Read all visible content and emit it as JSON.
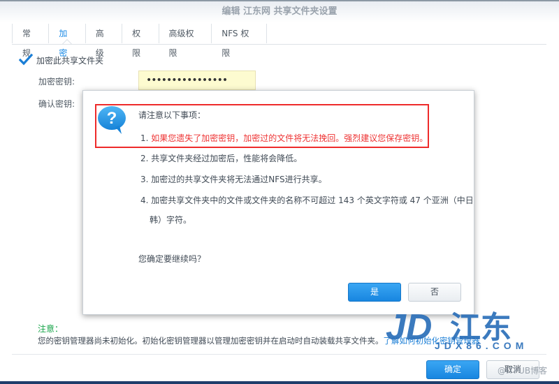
{
  "window": {
    "title": "编辑 江东网 共享文件夹设置"
  },
  "tabs": [
    {
      "label": "常规",
      "active": false
    },
    {
      "label": "加密",
      "active": true
    },
    {
      "label": "高级",
      "active": false
    },
    {
      "label": "权限",
      "active": false
    },
    {
      "label": "高级权限",
      "active": false
    },
    {
      "label": "NFS 权限",
      "active": false
    }
  ],
  "form": {
    "encrypt_checkbox_label": "加密此共享文件夹",
    "encrypt_checked": true,
    "encryption_key_label": "加密密钥:",
    "encryption_key_value": "••••••••••••••••",
    "confirm_key_label": "确认密钥:"
  },
  "dialog": {
    "icon": "question-bubble-icon",
    "heading": "请注意以下事项：",
    "items": [
      {
        "num": "1.",
        "text": "如果您遗失了加密密钥，加密过的文件将无法挽回。强烈建议您保存密钥。",
        "highlighted": true
      },
      {
        "num": "2.",
        "text": "共享文件夹经过加密后，性能将会降低。"
      },
      {
        "num": "3.",
        "text": "加密过的共享文件夹将无法通过NFS进行共享。"
      },
      {
        "num": "4.",
        "text": "加密共享文件夹中的文件或文件夹的名称不可超过 143 个英文字符或 47 个亚洲（中日",
        "continuation": "韩）字符。"
      }
    ],
    "question": "您确定要继续吗？",
    "yes_label": "是",
    "no_label": "否"
  },
  "note": {
    "title": "注意：",
    "text": "您的密钥管理器尚未初始化。初始化密钥管理器以管理加密密钥并在启动时自动装载共享文件夹。",
    "link": "了解如何初始化密钥管理器"
  },
  "footer": {
    "ok_label": "确定",
    "cancel_label": "取消"
  },
  "watermark": {
    "brand_letters": "JD",
    "brand_cn": "江东",
    "domain": "JDX86.COM",
    "credit": "@ITPUB博客"
  },
  "colors": {
    "accent": "#1a8ae6",
    "highlight_red": "#ee2a2a",
    "note_green": "#18a44a",
    "watermark_blue": "#2a6fb8"
  }
}
